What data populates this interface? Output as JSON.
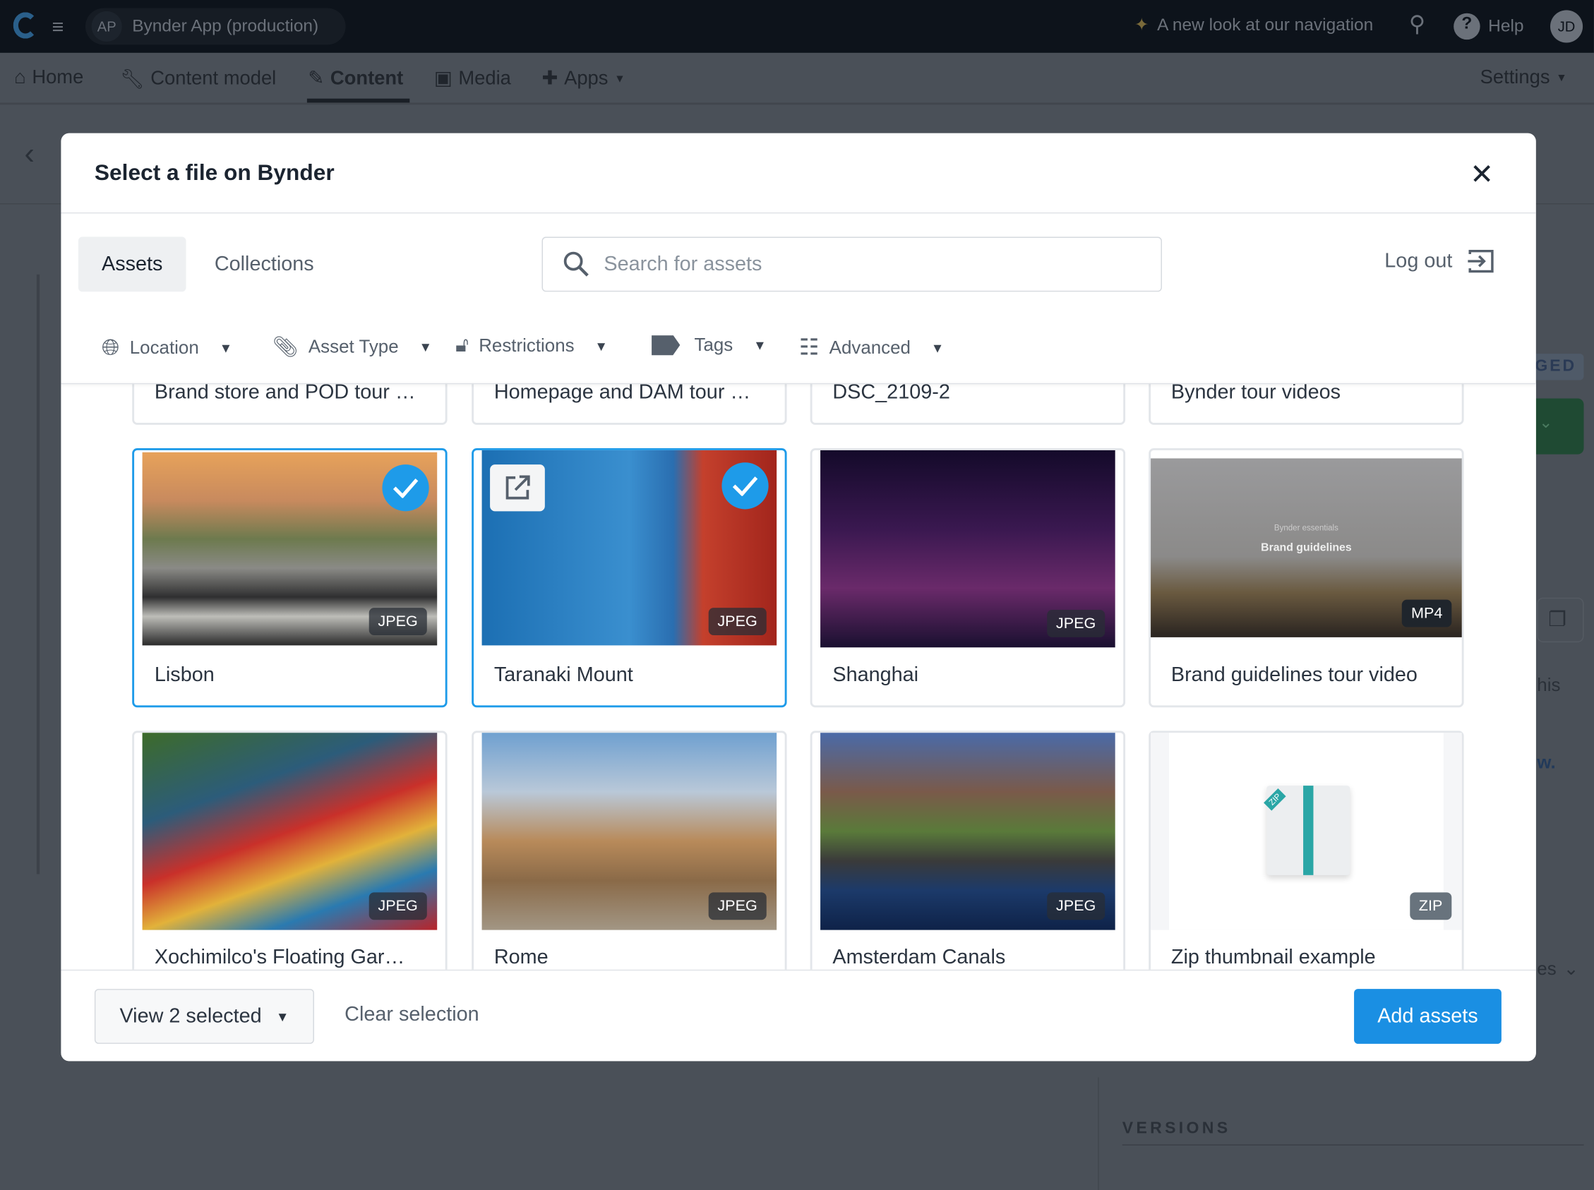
{
  "topbar": {
    "org_initials": "AP",
    "app_name": "Bynder App (production)",
    "announcement": "A new look at our navigation",
    "help": "Help",
    "user_initials": "JD"
  },
  "nav": {
    "items": [
      {
        "label": "Home",
        "icon": "home-icon"
      },
      {
        "label": "Content model",
        "icon": "wrench-icon"
      },
      {
        "label": "Content",
        "icon": "pen-icon",
        "active": true
      },
      {
        "label": "Media",
        "icon": "image-icon"
      },
      {
        "label": "Apps",
        "icon": "puzzle-icon"
      }
    ],
    "settings": "Settings"
  },
  "background": {
    "status_fragment": "GED",
    "text_fragment_1": "his",
    "text_fragment_2": "w.",
    "text_fragment_3": "es",
    "versions": "VERSIONS"
  },
  "modal": {
    "title": "Select a file on Bynder",
    "tabs": [
      {
        "label": "Assets",
        "active": true
      },
      {
        "label": "Collections",
        "active": false
      }
    ],
    "search": {
      "placeholder": "Search for assets",
      "value": ""
    },
    "logout": "Log out",
    "filters": [
      {
        "label": "Location",
        "icon": "globe-icon"
      },
      {
        "label": "Asset Type",
        "icon": "paperclip-icon"
      },
      {
        "label": "Restrictions",
        "icon": "lock-icon"
      },
      {
        "label": "Tags",
        "icon": "tag-icon"
      },
      {
        "label": "Advanced",
        "icon": "sliders-icon"
      }
    ],
    "assets": [
      {
        "name": "Brand store and POD tour …"
      },
      {
        "name": "Homepage and DAM tour …"
      },
      {
        "name": "DSC_2109-2"
      },
      {
        "name": "Bynder tour videos"
      },
      {
        "name": "Lisbon",
        "type": "JPEG",
        "selected": true
      },
      {
        "name": "Taranaki Mount",
        "type": "JPEG",
        "selected": true
      },
      {
        "name": "Shanghai",
        "type": "JPEG",
        "selected": false
      },
      {
        "name": "Brand guidelines tour video",
        "type": "MP4",
        "selected": false,
        "thumb_caption": "Brand guidelines",
        "thumb_subcaption": "Bynder essentials"
      },
      {
        "name": "Xochimilco's Floating Gar…",
        "type": "JPEG",
        "selected": false
      },
      {
        "name": "Rome",
        "type": "JPEG",
        "selected": false
      },
      {
        "name": "Amsterdam Canals",
        "type": "JPEG",
        "selected": false
      },
      {
        "name": "Zip thumbnail example",
        "type": "ZIP",
        "selected": false,
        "thumb_label": "ZIP"
      }
    ],
    "footer": {
      "view_selected": "View 2 selected",
      "clear": "Clear selection",
      "add": "Add assets"
    }
  },
  "colors": {
    "accent": "#1a8fe3",
    "selected_border": "#1e9be9",
    "topbar": "#0d131b"
  }
}
